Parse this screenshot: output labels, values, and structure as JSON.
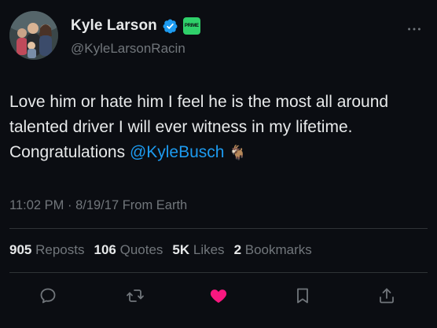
{
  "tweet": {
    "author": {
      "display_name": "Kyle Larson",
      "handle": "@KyleLarsonRacin",
      "verified": true,
      "prime_badge_text": "PRIME"
    },
    "text_before": "Love him or hate him I feel he is the most all around talented driver I will ever witness in my lifetime. Congratulations ",
    "mention": "@KyleBusch",
    "emoji": "🐐",
    "meta": "11:02 PM · 8/19/17 From Earth",
    "stats": {
      "reposts": {
        "count": "905",
        "label": "Reposts"
      },
      "quotes": {
        "count": "106",
        "label": "Quotes"
      },
      "likes": {
        "count": "5K",
        "label": "Likes"
      },
      "bookmarks": {
        "count": "2",
        "label": "Bookmarks"
      }
    }
  },
  "icons": {
    "more": "more-horizontal-icon",
    "reply": "reply-icon",
    "repost": "repost-icon",
    "like": "heart-icon",
    "bookmark": "bookmark-icon",
    "share": "share-icon"
  },
  "colors": {
    "background": "#0b0d12",
    "text": "#e7e9ea",
    "secondary": "#71767b",
    "mention": "#1d9bf0",
    "verified": "#1d9bf0",
    "like": "#f91880",
    "prime_badge": "#2fd06a",
    "divider": "#2f3336"
  }
}
